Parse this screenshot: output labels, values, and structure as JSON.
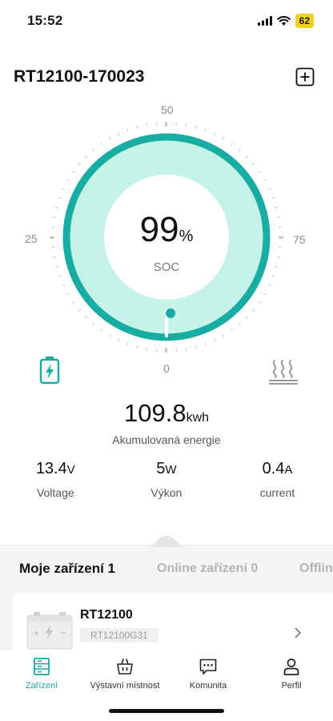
{
  "status": {
    "time": "15:52",
    "battery": "62"
  },
  "header": {
    "title": "RT12100-170023",
    "add_icon": "plus-square-icon"
  },
  "gauge": {
    "scale_top": "50",
    "scale_left": "25",
    "scale_right": "75",
    "scale_bottom": "0",
    "soc_value": "99",
    "soc_unit": "%",
    "soc_label": "SOC",
    "soc_level_percent": 99,
    "colors": {
      "ring": "#17ada3",
      "fill": "#c6f3e8",
      "inner": "#ffffff",
      "ticks": "#c8c8c8"
    }
  },
  "energy": {
    "value": "109.8",
    "unit": "kwh",
    "label": "Akumulovaná energie"
  },
  "metrics": [
    {
      "value": "13.4",
      "unit": "V",
      "label": "Voltage"
    },
    {
      "value": "5",
      "unit": "W",
      "label": "Výkon"
    },
    {
      "value": "0.4",
      "unit": "A",
      "label": "current"
    }
  ],
  "device_tabs": {
    "mine": "Moje zařízení 1",
    "online": "Online zařízení 0",
    "offline": "Offlin"
  },
  "device": {
    "name": "RT12100",
    "code": "RT12100G31"
  },
  "tabbar": [
    {
      "label": "Zařízení",
      "icon": "device-list-icon",
      "active": true
    },
    {
      "label": "Výstavní místnost",
      "icon": "shopping-basket-icon",
      "active": false
    },
    {
      "label": "Komunita",
      "icon": "chat-bubble-icon",
      "active": false
    },
    {
      "label": "Perfil",
      "icon": "user-icon",
      "active": false
    }
  ],
  "accent_color": "#16a9a0"
}
